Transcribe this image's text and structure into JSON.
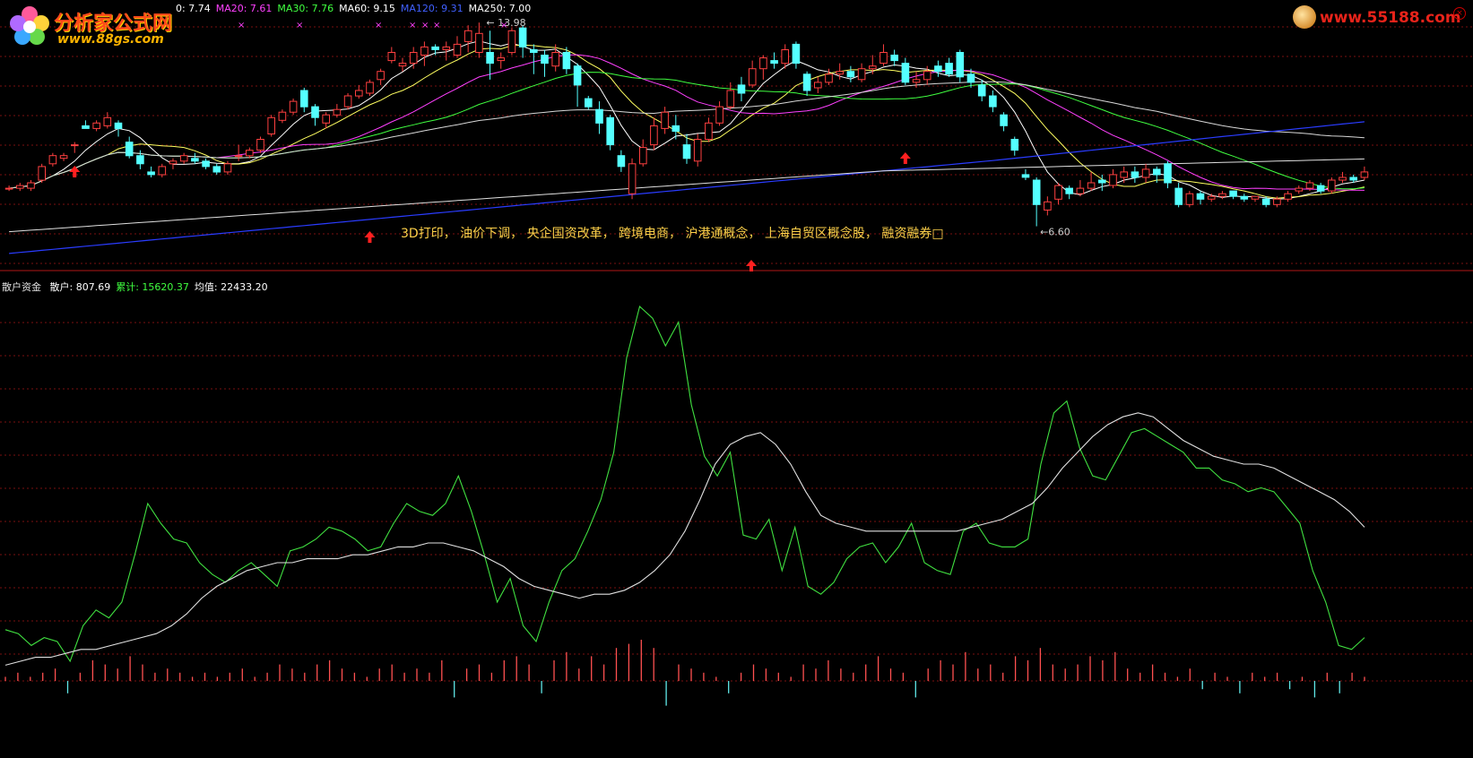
{
  "logos": {
    "left_brand": "分析家公式网",
    "left_url": "www.88gs.com",
    "right_url": "www.55188.com"
  },
  "main_legend": [
    {
      "label": "0: 7.74",
      "color": "#ffffff"
    },
    {
      "label": "MA20: 7.61",
      "color": "#ff40ff"
    },
    {
      "label": "MA30: 7.76",
      "color": "#40ff40"
    },
    {
      "label": "MA60: 9.15",
      "color": "#ffffff"
    },
    {
      "label": "MA120: 9.31",
      "color": "#4060ff"
    },
    {
      "label": "MA250: 7.00",
      "color": "#ffffff"
    }
  ],
  "concepts_text": "3D打印， 油价下调， 央企国资改革， 跨境电商， 沪港通概念， 上海自贸区概念股， 融资融券□",
  "sub_legend": {
    "name": "散户资金",
    "items": [
      {
        "label": "散户: 807.69",
        "color": "#ffffff"
      },
      {
        "label": "累计: 15620.37",
        "color": "#40ff40"
      },
      {
        "label": "均值: 22433.20",
        "color": "#ffffff"
      }
    ]
  },
  "chart_data": [
    {
      "type": "candlestick",
      "title": "",
      "price_range": [
        5.2,
        14.6
      ],
      "annotations": [
        {
          "label": "13.98",
          "kind": "high-marker"
        },
        {
          "label": "6.60",
          "kind": "low-marker"
        }
      ],
      "colors": {
        "up": "#ff4040",
        "down": "#54ffff",
        "grid": "#8a1010"
      },
      "candles": [
        [
          8.0,
          8.0,
          8.1,
          7.9
        ],
        [
          8.0,
          8.1,
          8.2,
          7.9
        ],
        [
          8.0,
          8.2,
          8.3,
          7.9
        ],
        [
          8.3,
          8.8,
          8.9,
          8.2
        ],
        [
          8.9,
          9.2,
          9.3,
          8.8
        ],
        [
          9.1,
          9.2,
          9.3,
          9.0
        ],
        [
          9.6,
          9.6,
          9.7,
          9.3
        ],
        [
          10.3,
          10.2,
          10.5,
          10.2
        ],
        [
          10.2,
          10.4,
          10.5,
          10.1
        ],
        [
          10.3,
          10.6,
          10.8,
          10.2
        ],
        [
          10.4,
          10.2,
          10.5,
          9.9
        ],
        [
          9.7,
          9.2,
          9.9,
          9.1
        ],
        [
          9.2,
          8.9,
          9.4,
          8.7
        ],
        [
          8.6,
          8.5,
          8.8,
          8.4
        ],
        [
          8.5,
          8.8,
          8.9,
          8.4
        ],
        [
          8.9,
          9.0,
          9.1,
          8.7
        ],
        [
          9.0,
          9.2,
          9.3,
          8.9
        ],
        [
          9.1,
          9.0,
          9.3,
          8.9
        ],
        [
          9.0,
          8.8,
          9.1,
          8.7
        ],
        [
          8.8,
          8.6,
          8.9,
          8.5
        ],
        [
          8.6,
          8.9,
          9.0,
          8.5
        ],
        [
          9.2,
          9.2,
          9.6,
          9.0
        ],
        [
          9.2,
          9.4,
          9.5,
          9.1
        ],
        [
          9.4,
          9.8,
          9.9,
          9.3
        ],
        [
          10.0,
          10.6,
          10.7,
          9.9
        ],
        [
          10.5,
          10.8,
          10.9,
          10.4
        ],
        [
          10.8,
          11.2,
          11.3,
          10.7
        ],
        [
          11.6,
          11.0,
          11.7,
          10.8
        ],
        [
          11.0,
          10.6,
          11.1,
          10.3
        ],
        [
          10.4,
          10.7,
          10.8,
          10.2
        ],
        [
          10.7,
          10.9,
          11.1,
          10.6
        ],
        [
          11.0,
          11.4,
          11.5,
          10.9
        ],
        [
          11.4,
          11.6,
          11.8,
          11.3
        ],
        [
          11.5,
          11.9,
          12.0,
          11.4
        ],
        [
          12.0,
          12.3,
          12.4,
          11.8
        ],
        [
          12.7,
          13.0,
          13.2,
          12.6
        ],
        [
          12.5,
          12.6,
          12.8,
          12.3
        ],
        [
          12.6,
          13.0,
          13.2,
          12.4
        ],
        [
          12.9,
          13.2,
          13.4,
          12.5
        ],
        [
          13.2,
          13.1,
          13.3,
          12.9
        ],
        [
          13.1,
          13.2,
          13.4,
          12.7
        ],
        [
          12.9,
          13.3,
          13.6,
          12.8
        ],
        [
          13.4,
          13.8,
          14.0,
          13.0
        ],
        [
          13.0,
          13.7,
          14.1,
          12.8
        ],
        [
          13.0,
          12.6,
          13.8,
          12.0
        ],
        [
          12.7,
          12.8,
          13.0,
          12.4
        ],
        [
          13.0,
          13.8,
          13.9,
          12.9
        ],
        [
          13.9,
          13.2,
          13.98,
          12.8
        ],
        [
          13.1,
          13.0,
          13.3,
          12.2
        ],
        [
          12.9,
          12.6,
          13.1,
          12.1
        ],
        [
          12.5,
          13.0,
          13.3,
          12.3
        ],
        [
          13.0,
          12.4,
          13.2,
          12.2
        ],
        [
          12.5,
          11.8,
          12.6,
          11.0
        ],
        [
          11.3,
          11.0,
          11.4,
          10.9
        ],
        [
          10.9,
          10.4,
          11.2,
          10.0
        ],
        [
          10.6,
          9.6,
          10.7,
          9.4
        ],
        [
          9.2,
          8.8,
          9.4,
          8.6
        ],
        [
          7.8,
          8.9,
          9.1,
          7.6
        ],
        [
          8.9,
          9.5,
          9.8,
          8.8
        ],
        [
          9.6,
          10.3,
          10.6,
          9.4
        ],
        [
          10.2,
          10.8,
          11.0,
          10.0
        ],
        [
          10.3,
          10.1,
          10.7,
          9.8
        ],
        [
          9.6,
          9.1,
          10.0,
          8.9
        ],
        [
          9.0,
          9.8,
          10.0,
          8.8
        ],
        [
          9.8,
          10.4,
          10.6,
          9.7
        ],
        [
          10.4,
          11.0,
          11.2,
          10.3
        ],
        [
          11.0,
          11.6,
          11.9,
          10.9
        ],
        [
          11.8,
          11.5,
          12.1,
          11.2
        ],
        [
          11.8,
          12.4,
          12.7,
          11.7
        ],
        [
          12.4,
          12.8,
          12.9,
          12.0
        ],
        [
          12.7,
          12.6,
          13.0,
          12.4
        ],
        [
          12.6,
          13.1,
          13.3,
          12.4
        ],
        [
          13.3,
          12.6,
          13.4,
          12.4
        ],
        [
          12.2,
          11.6,
          12.3,
          11.4
        ],
        [
          11.7,
          11.9,
          12.1,
          11.5
        ],
        [
          11.9,
          12.2,
          12.4,
          11.8
        ],
        [
          12.2,
          12.3,
          12.6,
          12.0
        ],
        [
          12.3,
          12.1,
          12.5,
          11.9
        ],
        [
          12.0,
          12.4,
          12.6,
          11.9
        ],
        [
          12.4,
          12.5,
          12.9,
          12.2
        ],
        [
          12.6,
          13.0,
          13.3,
          12.5
        ],
        [
          12.9,
          12.7,
          13.1,
          12.5
        ],
        [
          12.6,
          11.9,
          12.8,
          11.8
        ],
        [
          11.9,
          12.0,
          12.3,
          11.7
        ],
        [
          12.0,
          12.3,
          12.5,
          11.8
        ],
        [
          12.5,
          12.3,
          12.7,
          12.1
        ],
        [
          12.6,
          12.2,
          12.8,
          12.1
        ],
        [
          13.0,
          12.1,
          13.1,
          11.9
        ],
        [
          12.2,
          11.9,
          12.4,
          11.7
        ],
        [
          11.8,
          11.4,
          12.0,
          11.2
        ],
        [
          11.4,
          11.0,
          11.6,
          10.8
        ],
        [
          10.7,
          10.3,
          10.8,
          10.1
        ],
        [
          9.8,
          9.4,
          9.9,
          9.2
        ],
        [
          8.5,
          8.4,
          8.7,
          8.3
        ],
        [
          8.3,
          7.4,
          8.4,
          6.6
        ],
        [
          7.2,
          7.5,
          7.7,
          7.0
        ],
        [
          7.6,
          8.1,
          8.2,
          7.4
        ],
        [
          8.0,
          7.8,
          8.1,
          7.6
        ],
        [
          7.8,
          8.0,
          8.3,
          7.7
        ],
        [
          8.0,
          8.2,
          8.6,
          7.9
        ],
        [
          8.3,
          8.2,
          8.5,
          7.9
        ],
        [
          8.1,
          8.5,
          8.7,
          8.0
        ],
        [
          8.4,
          8.6,
          8.8,
          8.2
        ],
        [
          8.6,
          8.4,
          8.8,
          8.2
        ],
        [
          8.4,
          8.7,
          8.9,
          8.2
        ],
        [
          8.7,
          8.5,
          8.8,
          8.2
        ],
        [
          8.9,
          8.2,
          9.0,
          8.0
        ],
        [
          8.0,
          7.4,
          8.2,
          7.3
        ],
        [
          7.4,
          7.8,
          7.9,
          7.3
        ],
        [
          7.8,
          7.6,
          7.9,
          7.4
        ],
        [
          7.6,
          7.7,
          7.8,
          7.5
        ],
        [
          7.7,
          7.8,
          7.9,
          7.6
        ],
        [
          7.9,
          7.7,
          7.9,
          7.6
        ],
        [
          7.7,
          7.6,
          7.8,
          7.5
        ],
        [
          7.6,
          7.7,
          7.7,
          7.5
        ],
        [
          7.6,
          7.4,
          7.7,
          7.3
        ],
        [
          7.4,
          7.6,
          7.7,
          7.3
        ],
        [
          7.6,
          7.8,
          7.9,
          7.5
        ],
        [
          7.9,
          8.0,
          8.1,
          7.8
        ],
        [
          8.0,
          8.2,
          8.3,
          7.9
        ],
        [
          8.1,
          7.9,
          8.2,
          7.8
        ],
        [
          7.9,
          8.3,
          8.4,
          7.8
        ],
        [
          8.3,
          8.4,
          8.6,
          8.2
        ],
        [
          8.4,
          8.3,
          8.5,
          8.2
        ],
        [
          8.4,
          8.6,
          8.8,
          8.3
        ]
      ],
      "signals": [
        {
          "index": 6,
          "kind": "arrow-up"
        },
        {
          "index": 33,
          "kind": "arrow-up"
        },
        {
          "index": 82,
          "kind": "arrow-up"
        }
      ]
    },
    {
      "type": "line",
      "title": "散户资金",
      "y_range": [
        0,
        100
      ],
      "series": [
        {
          "name": "累计",
          "color": "#40e040",
          "values": [
            13,
            12,
            9,
            11,
            10,
            5,
            14,
            18,
            16,
            20,
            32,
            45,
            40,
            36,
            35,
            30,
            27,
            25,
            28,
            30,
            27,
            24,
            33,
            34,
            36,
            39,
            38,
            36,
            33,
            34,
            40,
            45,
            43,
            42,
            45,
            52,
            43,
            32,
            20,
            26,
            14,
            10,
            20,
            28,
            31,
            38,
            46,
            58,
            82,
            95,
            92,
            85,
            91,
            70,
            57,
            52,
            58,
            37,
            36,
            41,
            28,
            39,
            24,
            22,
            25,
            31,
            34,
            35,
            30,
            34,
            40,
            30,
            28,
            27,
            38,
            40,
            35,
            34,
            34,
            36,
            55,
            68,
            71,
            59,
            52,
            51,
            57,
            63,
            64,
            62,
            60,
            58,
            54,
            54,
            51,
            50,
            48,
            49,
            48,
            44,
            40,
            28,
            20,
            9,
            8,
            11
          ]
        },
        {
          "name": "均值",
          "color": "#e0e0e0",
          "values": [
            4,
            5,
            6,
            6,
            7,
            8,
            8,
            9,
            10,
            11,
            12,
            14,
            17,
            21,
            24,
            26,
            28,
            29,
            30,
            30,
            31,
            31,
            31,
            32,
            32,
            33,
            34,
            34,
            35,
            35,
            34,
            33,
            31,
            29,
            26,
            24,
            23,
            22,
            21,
            22,
            22,
            23,
            25,
            28,
            32,
            38,
            46,
            55,
            60,
            62,
            63,
            60,
            55,
            48,
            42,
            40,
            39,
            38,
            38,
            38,
            38,
            38,
            38,
            38,
            39,
            40,
            41,
            43,
            45,
            49,
            54,
            58,
            62,
            65,
            67,
            68,
            67,
            64,
            61,
            59,
            57,
            56,
            55,
            55,
            54,
            52,
            50,
            48,
            46,
            43,
            39
          ]
        }
      ],
      "volume_bars": [
        1,
        2,
        1,
        2,
        3,
        -3,
        2,
        5,
        4,
        3,
        6,
        4,
        2,
        3,
        2,
        1,
        2,
        1,
        2,
        3,
        1,
        2,
        4,
        3,
        2,
        4,
        5,
        3,
        2,
        1,
        3,
        4,
        2,
        3,
        2,
        5,
        -4,
        3,
        4,
        2,
        5,
        6,
        4,
        -3,
        5,
        7,
        3,
        6,
        4,
        8,
        9,
        10,
        8,
        -6,
        4,
        3,
        2,
        1,
        -3,
        2,
        4,
        3,
        2,
        1,
        4,
        3,
        5,
        3,
        2,
        4,
        6,
        3,
        2,
        -4,
        3,
        5,
        4,
        7,
        3,
        4,
        2,
        6,
        5,
        8,
        4,
        3,
        4,
        6,
        5,
        7,
        3,
        2,
        4,
        2,
        1,
        3,
        -2,
        2,
        1,
        -3,
        2,
        1,
        2,
        -2,
        1,
        -4,
        2,
        -3,
        2,
        1
      ]
    }
  ]
}
